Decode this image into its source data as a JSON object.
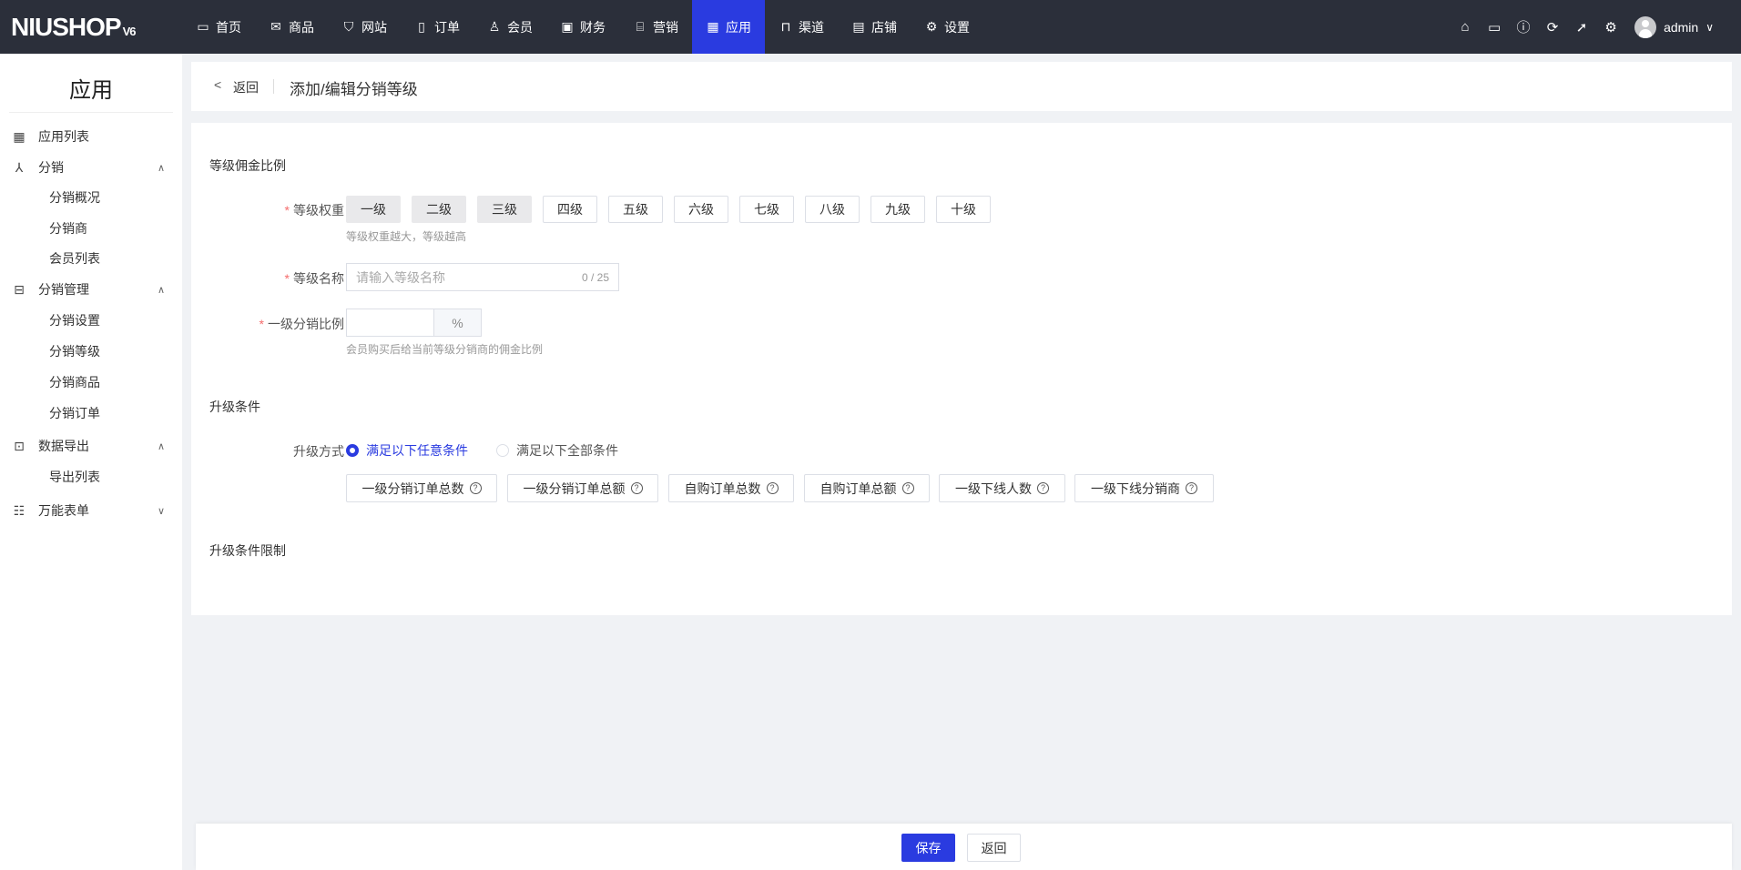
{
  "topbar": {
    "logo": "NIUSHOP",
    "logo_version": "V6",
    "nav": [
      {
        "label": "首页",
        "icon": "monitor-icon",
        "glyph": "▭"
      },
      {
        "label": "商品",
        "icon": "goods-icon",
        "glyph": "✉"
      },
      {
        "label": "网站",
        "icon": "website-icon",
        "glyph": "⛉"
      },
      {
        "label": "订单",
        "icon": "order-icon",
        "glyph": "▯"
      },
      {
        "label": "会员",
        "icon": "member-icon",
        "glyph": "♙"
      },
      {
        "label": "财务",
        "icon": "finance-icon",
        "glyph": "▣"
      },
      {
        "label": "营销",
        "icon": "marketing-icon",
        "glyph": "⌸"
      },
      {
        "label": "应用",
        "icon": "app-icon",
        "glyph": "▦"
      },
      {
        "label": "渠道",
        "icon": "channel-icon",
        "glyph": "⊓"
      },
      {
        "label": "店铺",
        "icon": "shop-icon",
        "glyph": "▤"
      },
      {
        "label": "设置",
        "icon": "gear-icon",
        "glyph": "⚙"
      }
    ],
    "active_index": 7,
    "user": "admin"
  },
  "sidebar": {
    "title": "应用",
    "items": [
      {
        "label": "应用列表"
      },
      {
        "label": "分销"
      },
      {
        "label": "分销概况"
      },
      {
        "label": "分销商"
      },
      {
        "label": "会员列表"
      },
      {
        "label": "分销管理"
      },
      {
        "label": "分销设置"
      },
      {
        "label": "分销等级"
      },
      {
        "label": "分销商品"
      },
      {
        "label": "分销订单"
      },
      {
        "label": "数据导出"
      },
      {
        "label": "导出列表"
      },
      {
        "label": "万能表单"
      }
    ]
  },
  "header": {
    "back": "返回",
    "title": "添加/编辑分销等级"
  },
  "form": {
    "section1": "等级佣金比例",
    "weight_label": "等级权重",
    "levels": [
      "一级",
      "二级",
      "三级",
      "四级",
      "五级",
      "六级",
      "七级",
      "八级",
      "九级",
      "十级"
    ],
    "weight_hint": "等级权重越大，等级越高",
    "name_label": "等级名称",
    "name_placeholder": "请输入等级名称",
    "name_count": "0 / 25",
    "ratio_label": "一级分销比例",
    "ratio_value": "",
    "ratio_unit": "%",
    "ratio_hint": "会员购买后给当前等级分销商的佣金比例",
    "section2": "升级条件",
    "upgrade_label": "升级方式",
    "upgrade_options": [
      "满足以下任意条件",
      "满足以下全部条件"
    ],
    "conditions": [
      "一级分销订单总数",
      "一级分销订单总额",
      "自购订单总数",
      "自购订单总额",
      "一级下线人数",
      "一级下线分销商"
    ],
    "section3": "升级条件限制"
  },
  "footer": {
    "save": "保存",
    "back": "返回"
  },
  "colors": {
    "topbar": "#2b2f3a",
    "primary": "#2a3be0"
  }
}
